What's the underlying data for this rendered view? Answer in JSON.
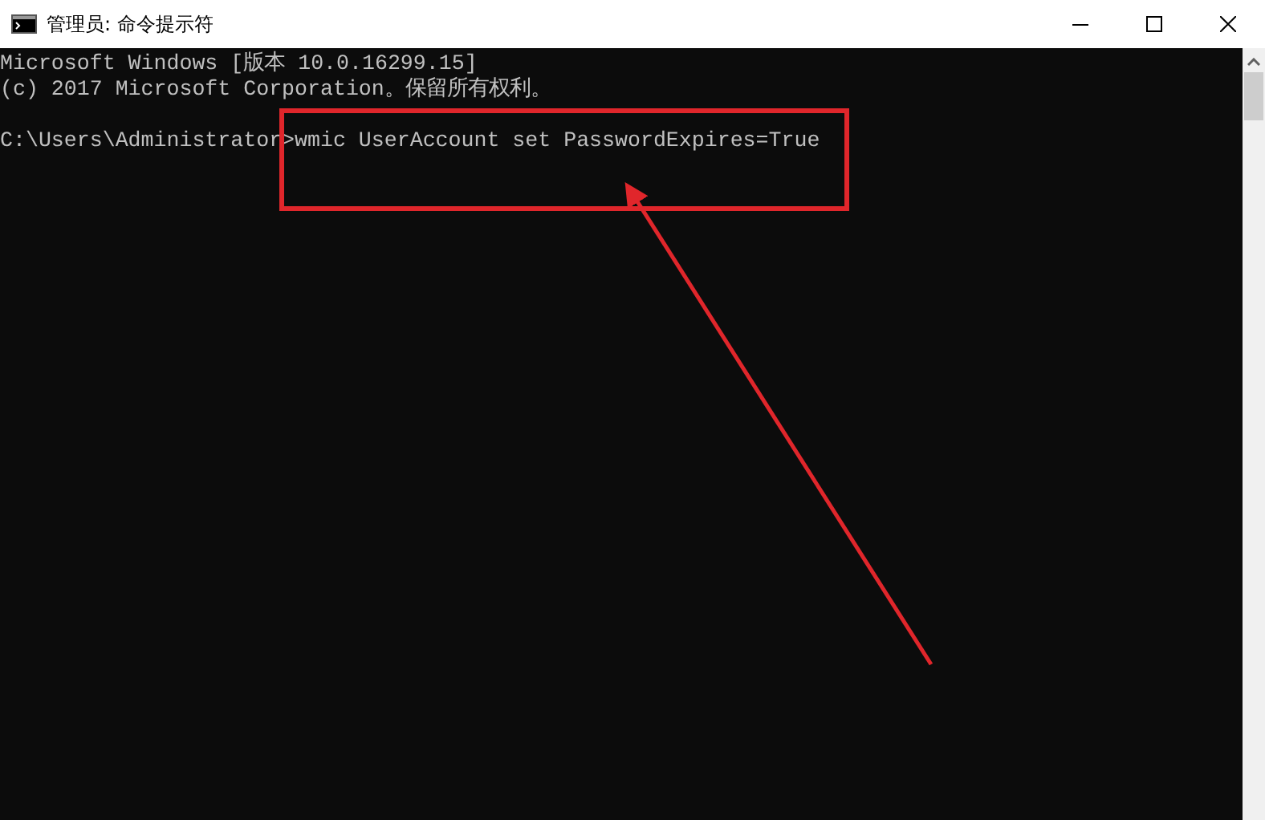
{
  "window": {
    "title": "管理员: 命令提示符"
  },
  "console": {
    "lines": [
      {
        "kind": "output",
        "text": "Microsoft Windows [版本 10.0.16299.15]"
      },
      {
        "kind": "output",
        "text": "(c) 2017 Microsoft Corporation。保留所有权利。"
      },
      {
        "kind": "prompt",
        "text": "C:\\Users\\Administrator>wmic UserAccount set PasswordExpires=True"
      }
    ]
  }
}
